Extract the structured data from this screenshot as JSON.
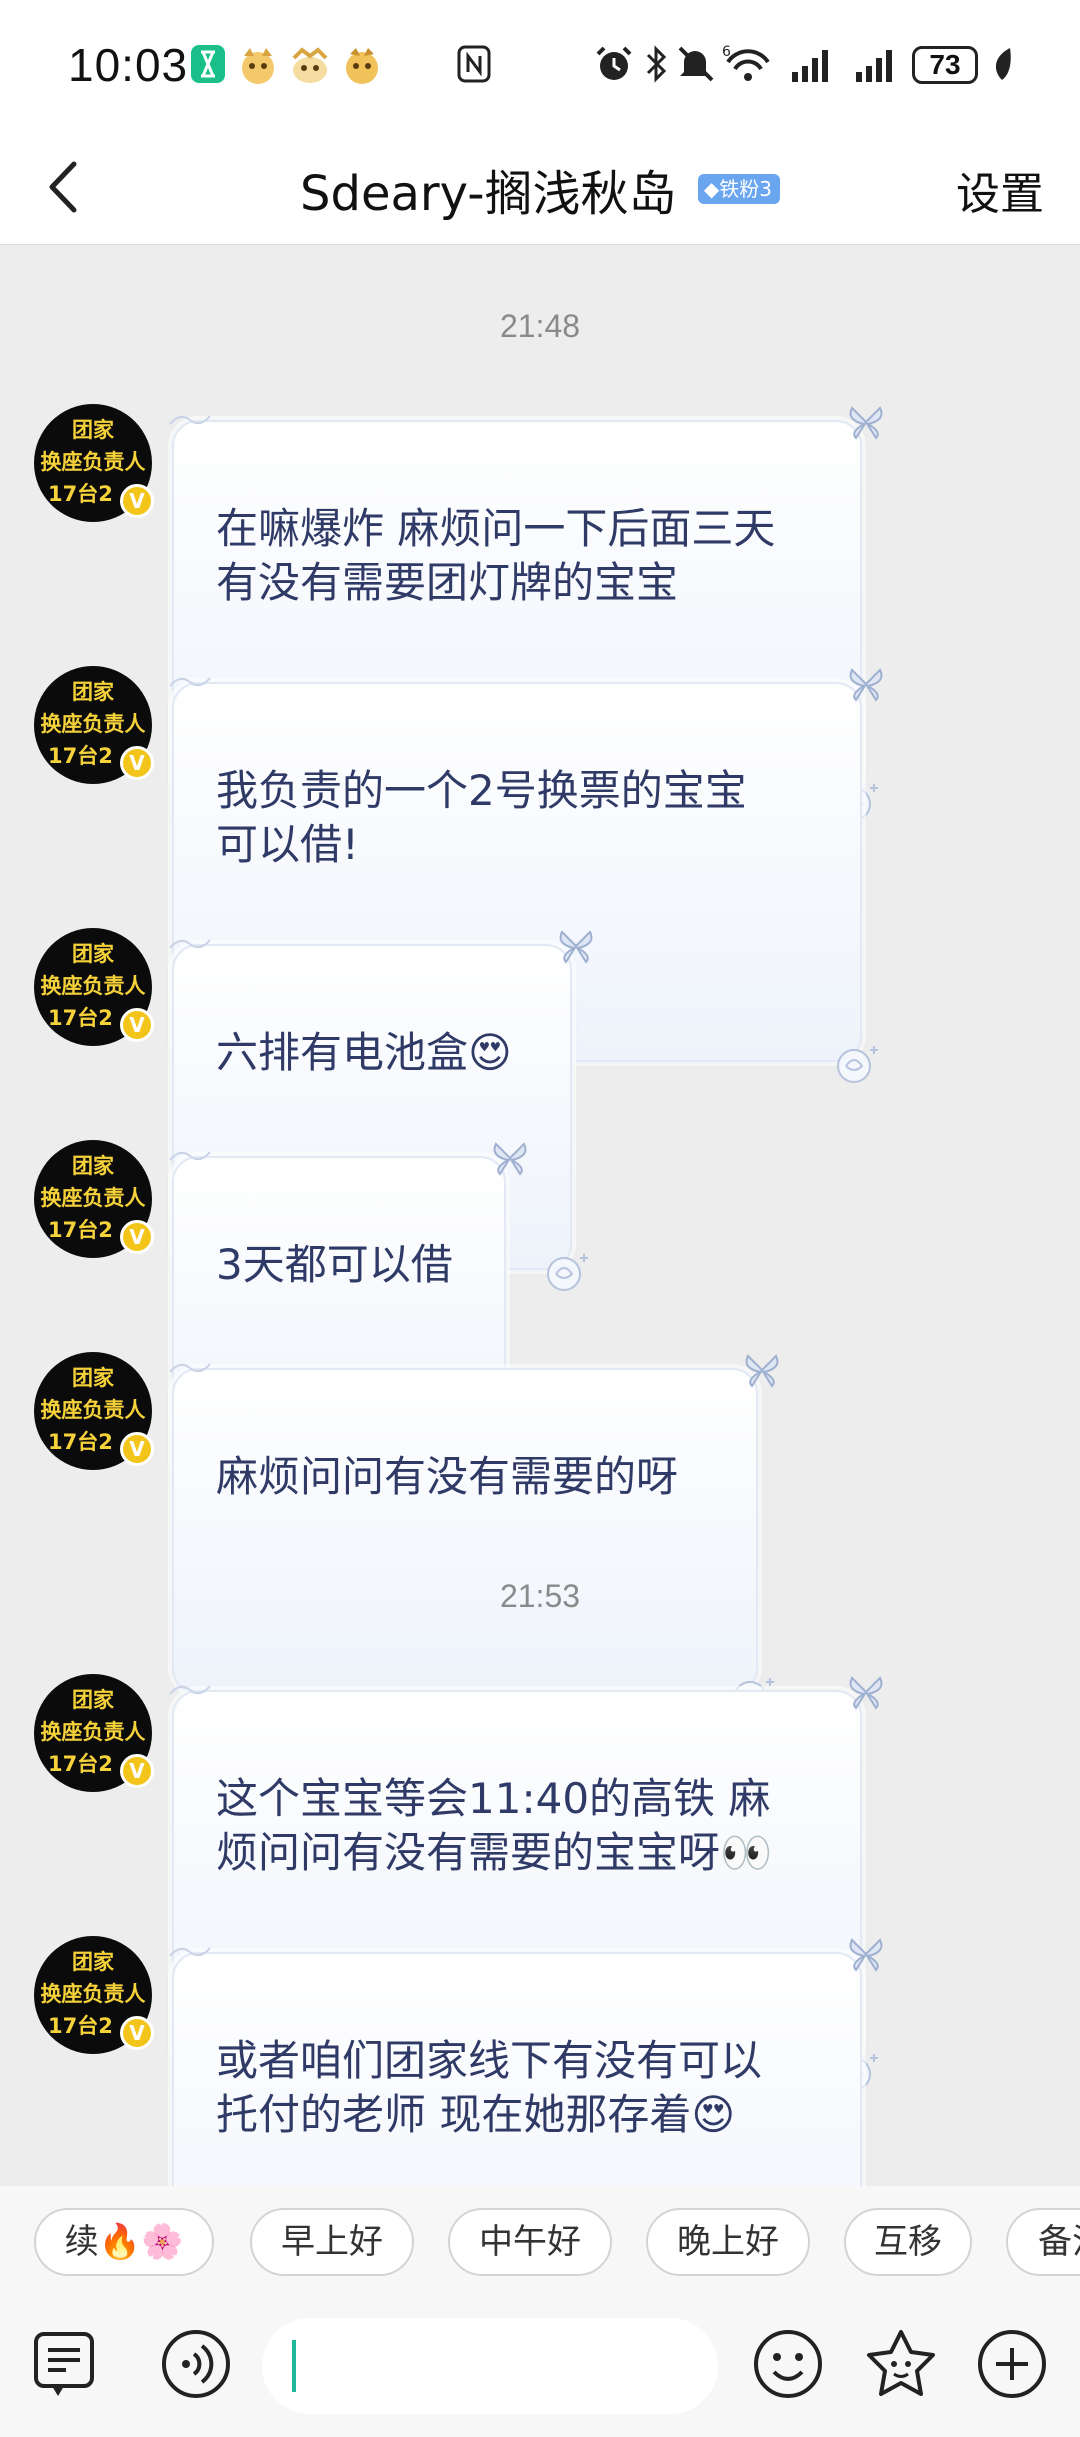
{
  "status_bar": {
    "time": "10:03",
    "battery": "73",
    "icons": [
      "hourglass-icon",
      "sticker-icon",
      "sticker-icon",
      "sticker-icon",
      "nfc-icon",
      "alarm-icon",
      "bluetooth-icon",
      "mute-icon",
      "wifi-icon",
      "signal-icon",
      "signal-icon",
      "battery-icon",
      "leaf-icon"
    ]
  },
  "header": {
    "title": "Sdeary-搁浅秋岛",
    "badge": "铁粉3",
    "settings": "设置"
  },
  "avatar": {
    "line1": "团家",
    "line2": "换座负责人",
    "line3": "17台2",
    "verified": "V"
  },
  "timestamps": [
    "21:48",
    "21:53"
  ],
  "messages": [
    {
      "text": "在嘛爆炸 麻烦问一下后面三天\n有没有需要团灯牌的宝宝"
    },
    {
      "text": "我负责的一个2号换票的宝宝\n可以借!"
    },
    {
      "text": "六排有电池盒😍"
    },
    {
      "text": "3天都可以借"
    },
    {
      "text": "麻烦问问有没有需要的呀"
    },
    {
      "text": "这个宝宝等会11:40的高铁 麻\n烦问问有没有需要的宝宝呀👀"
    },
    {
      "text": "或者咱们团家线下有没有可以\n托付的老师 现在她那存着😍"
    }
  ],
  "quick_replies": [
    "续🔥🌸",
    "早上好",
    "中午好",
    "晚上好",
    "互移",
    "备注"
  ],
  "input": {
    "value": "",
    "icons": [
      "note-icon",
      "voice-icon",
      "emoji-icon",
      "sticker-icon",
      "plus-icon"
    ]
  },
  "colors": {
    "bubble_text": "#2f3a66",
    "chat_bg": "#ededed",
    "badge_bg": "#6aa5f0",
    "caret": "#1fb89a",
    "avatar_text": "#f6d23a"
  }
}
